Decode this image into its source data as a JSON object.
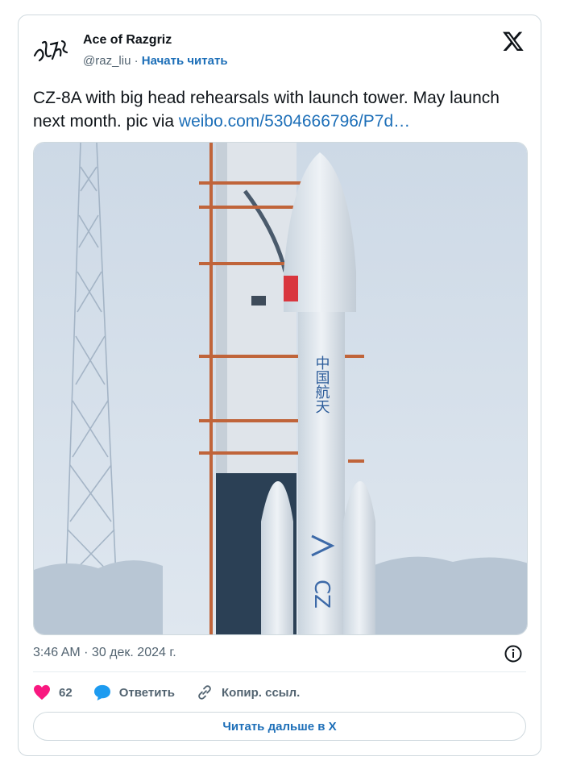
{
  "author": {
    "name": "Ace of Razgriz",
    "handle": "@raz_liu",
    "separator": "·",
    "follow_label": "Начать читать"
  },
  "brand_icon": "x-logo-icon",
  "tweet": {
    "text": "CZ-8A with big head rehearsals with launch tower. May launch next month. pic via ",
    "link_text": "weibo.com/5304666796/P7d…"
  },
  "media": {
    "rocket_text_vertical": "中国航天",
    "rocket_text_booster": "CZ"
  },
  "timestamp": "3:46 AM · 30 дек. 2024 г.",
  "actions": {
    "like_count": "62",
    "reply_label": "Ответить",
    "copy_link_label": "Копир. ссыл."
  },
  "read_more_label": "Читать дальше в X",
  "colors": {
    "link": "#1d6fb8",
    "like": "#f91880",
    "reply": "#1d9bf0",
    "border": "#cfd9de"
  }
}
